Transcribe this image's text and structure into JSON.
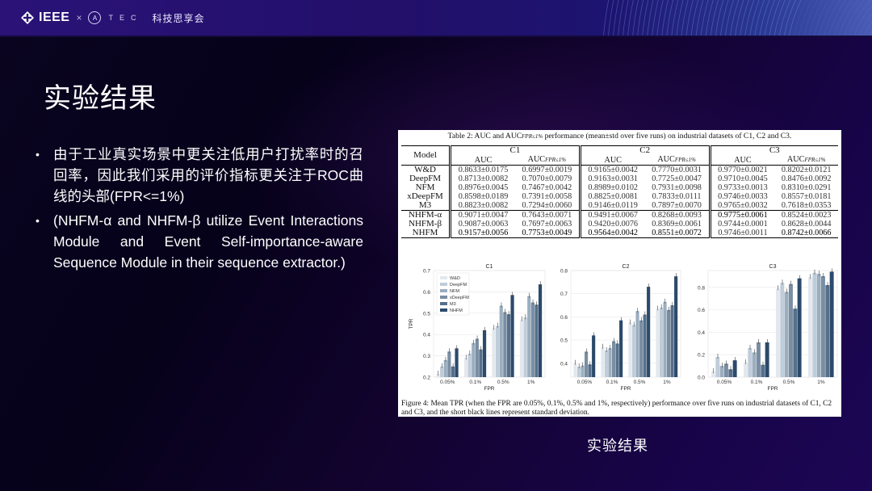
{
  "header": {
    "logo_ieee": "IEEE",
    "logo_times": "×",
    "logo_tec_mark": "A",
    "logo_tec": "TEC",
    "brand_cn": "科技思享会"
  },
  "slide": {
    "title": "实验结果",
    "bullets": [
      {
        "text": "由于工业真实场景中更关注低用户打扰率时的召回率，因此我们采用的评价指标更关注于ROC曲线的头部(FPR<=1%)"
      },
      {
        "text": "(NHFM-α and NHFM-β utilize Event Interactions Module and Event Self-importance-aware Sequence Module in their sequence extractor.)"
      }
    ],
    "image_caption": "实验结果"
  },
  "table": {
    "caption": "Table 2: AUC and AUC",
    "caption_sub": "FPR≤1%",
    "caption_rest": " performance (mean±std over five runs) on industrial datasets of C1, C2 and C3.",
    "model_header": "Model",
    "groups": [
      "C1",
      "C2",
      "C3"
    ],
    "col_auc": "AUC",
    "col_auc_fpr": "AUC",
    "col_auc_fpr_sub": "FPR≤1%",
    "rows": [
      {
        "model": "W&D",
        "values": [
          "0.8633±0.0175",
          "0.6997±0.0019",
          "0.9165±0.0042",
          "0.7770±0.0031",
          "0.9770±0.0021",
          "0.8202±0.0121"
        ],
        "bold": []
      },
      {
        "model": "DeepFM",
        "values": [
          "0.8713±0.0082",
          "0.7070±0.0079",
          "0.9163±0.0031",
          "0.7725±0.0047",
          "0.9710±0.0045",
          "0.8476±0.0092"
        ],
        "bold": []
      },
      {
        "model": "NFM",
        "values": [
          "0.8976±0.0045",
          "0.7467±0.0042",
          "0.8989±0.0102",
          "0.7931±0.0098",
          "0.9733±0.0013",
          "0.8310±0.0291"
        ],
        "bold": []
      },
      {
        "model": "xDeepFM",
        "values": [
          "0.8598±0.0189",
          "0.7391±0.0058",
          "0.8825±0.0081",
          "0.7833±0.0111",
          "0.9746±0.0033",
          "0.8557±0.0181"
        ],
        "bold": []
      },
      {
        "model": "M3",
        "values": [
          "0.8823±0.0082",
          "0.7294±0.0060",
          "0.9146±0.0119",
          "0.7897±0.0070",
          "0.9765±0.0032",
          "0.7618±0.0353"
        ],
        "bold": []
      },
      {
        "model": "NHFM-α",
        "values": [
          "0.9071±0.0047",
          "0.7643±0.0071",
          "0.9491±0.0067",
          "0.8268±0.0093",
          "0.9775±0.0061",
          "0.8524±0.0023"
        ],
        "bold": [
          4
        ]
      },
      {
        "model": "NHFM-β",
        "values": [
          "0.9087±0.0063",
          "0.7697±0.0063",
          "0.9420±0.0076",
          "0.8369±0.0061",
          "0.9744±0.0001",
          "0.8628±0.0044"
        ],
        "bold": []
      },
      {
        "model": "NHFM",
        "values": [
          "0.9157±0.0056",
          "0.7753±0.0049",
          "0.9564±0.0042",
          "0.8551±0.0072",
          "0.9746±0.0011",
          "0.8742±0.0066"
        ],
        "bold": [
          0,
          1,
          2,
          3,
          5
        ],
        "bold_model": true
      }
    ]
  },
  "figure_caption": "Figure 4: Mean TPR (when the FPR are 0.05%, 0.1%, 0.5% and 1%, respectively) performance over five runs on industrial datasets of C1, C2 and C3, and the short black lines represent standard deviation.",
  "colors": {
    "series": [
      "#e3e8ee",
      "#bfccd9",
      "#9aaebf",
      "#7a8ea3",
      "#56708a",
      "#2b4a6b"
    ]
  },
  "chart_data": [
    {
      "type": "bar",
      "title": "C1",
      "xlabel": "FPR",
      "ylabel": "TPR",
      "categories": [
        "0.05%",
        "0.1%",
        "0.5%",
        "1%"
      ],
      "ylim": [
        0.2,
        0.7
      ],
      "yticks": [
        0.2,
        0.3,
        0.4,
        0.5,
        0.6,
        0.7
      ],
      "legend": "top-left",
      "series": [
        {
          "name": "W&D",
          "values": [
            0.215,
            0.29,
            0.43,
            0.47
          ]
        },
        {
          "name": "DeepFM",
          "values": [
            0.25,
            0.31,
            0.44,
            0.48
          ]
        },
        {
          "name": "NFM",
          "values": [
            0.28,
            0.36,
            0.535,
            0.58
          ]
        },
        {
          "name": "xDeepFM",
          "values": [
            0.32,
            0.38,
            0.505,
            0.55
          ]
        },
        {
          "name": "M3",
          "values": [
            0.25,
            0.33,
            0.495,
            0.54
          ]
        },
        {
          "name": "NHFM",
          "values": [
            0.335,
            0.42,
            0.585,
            0.635
          ]
        }
      ]
    },
    {
      "type": "bar",
      "title": "C2",
      "xlabel": "FPR",
      "ylabel": "",
      "categories": [
        "0.05%",
        "0.1%",
        "0.5%",
        "1%"
      ],
      "ylim": [
        0.34,
        0.8
      ],
      "yticks": [
        0.4,
        0.5,
        0.6,
        0.7,
        0.8
      ],
      "series": [
        {
          "name": "W&D",
          "values": [
            0.4,
            0.47,
            0.575,
            0.635
          ]
        },
        {
          "name": "DeepFM",
          "values": [
            0.385,
            0.455,
            0.565,
            0.64
          ]
        },
        {
          "name": "NFM",
          "values": [
            0.39,
            0.465,
            0.625,
            0.665
          ]
        },
        {
          "name": "xDeepFM",
          "values": [
            0.45,
            0.495,
            0.585,
            0.63
          ]
        },
        {
          "name": "M3",
          "values": [
            0.395,
            0.485,
            0.61,
            0.65
          ]
        },
        {
          "name": "NHFM",
          "values": [
            0.52,
            0.585,
            0.73,
            0.775
          ]
        }
      ]
    },
    {
      "type": "bar",
      "title": "C3",
      "xlabel": "FPR",
      "ylabel": "",
      "categories": [
        "0.05%",
        "0.1%",
        "0.5%",
        "1%"
      ],
      "ylim": [
        0.0,
        0.95
      ],
      "yticks": [
        0.0,
        0.2,
        0.4,
        0.6,
        0.8
      ],
      "series": [
        {
          "name": "W&D",
          "values": [
            0.05,
            0.13,
            0.79,
            0.89
          ]
        },
        {
          "name": "DeepFM",
          "values": [
            0.18,
            0.26,
            0.84,
            0.93
          ]
        },
        {
          "name": "NFM",
          "values": [
            0.1,
            0.22,
            0.76,
            0.92
          ]
        },
        {
          "name": "xDeepFM",
          "values": [
            0.12,
            0.31,
            0.83,
            0.9
          ]
        },
        {
          "name": "M3",
          "values": [
            0.07,
            0.11,
            0.61,
            0.82
          ]
        },
        {
          "name": "NHFM",
          "values": [
            0.15,
            0.31,
            0.88,
            0.94
          ]
        }
      ]
    }
  ]
}
